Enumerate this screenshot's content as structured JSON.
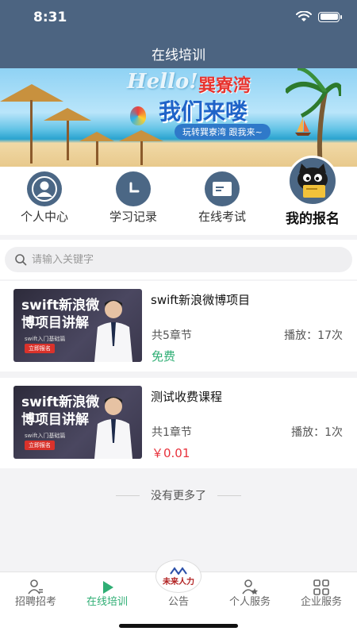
{
  "status_bar": {
    "time": "8:31"
  },
  "header": {
    "title": "在线培训"
  },
  "banner": {
    "hello": "Hello!",
    "place": "巽寮湾",
    "main": "我们来喽",
    "sub": "玩转巽寮湾  跟我来~"
  },
  "menu": {
    "items": [
      {
        "label": "个人中心",
        "icon": "user-icon"
      },
      {
        "label": "学习记录",
        "icon": "clock-icon"
      },
      {
        "label": "在线考试",
        "icon": "exam-card-icon"
      },
      {
        "label": "我的报名",
        "icon": "cat-avatar-icon"
      }
    ]
  },
  "search": {
    "placeholder": "请输入关键字"
  },
  "courses": [
    {
      "thumb_title": "swift新浪微博项目讲解",
      "thumb_sub": "swift入门基础篇",
      "thumb_button": "立即报名",
      "title": "swift新浪微博项目",
      "chapters": "共5章节",
      "plays": "播放：17次",
      "price": "免费"
    },
    {
      "thumb_title": "swift新浪微博项目讲解",
      "thumb_sub": "swift入门基础篇",
      "thumb_button": "立即报名",
      "title": "测试收费课程",
      "chapters": "共1章节",
      "plays": "播放：1次",
      "price": "￥0.01"
    }
  ],
  "footer_note": "没有更多了",
  "tabbar": {
    "items": [
      {
        "label": "招聘招考",
        "icon": "person-icon"
      },
      {
        "label": "在线培训",
        "icon": "play-icon",
        "active": true
      },
      {
        "label": "公告",
        "icon": "company-logo",
        "logo_text": "未来人力"
      },
      {
        "label": "个人服务",
        "icon": "person-star-icon"
      },
      {
        "label": "企业服务",
        "icon": "grid-icon"
      }
    ]
  },
  "colors": {
    "header": "#4c6481",
    "accent": "#2fae74",
    "price": "#e8323c",
    "icon_bg": "#4b6785"
  }
}
